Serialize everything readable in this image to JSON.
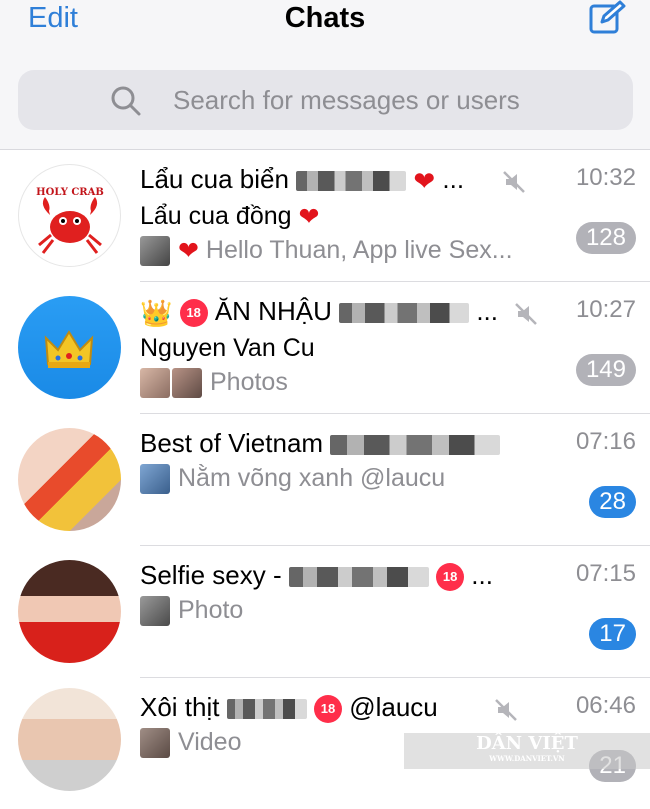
{
  "header": {
    "edit_label": "Edit",
    "title": "Chats",
    "compose_icon": "compose-icon"
  },
  "search": {
    "placeholder": "Search for messages or users"
  },
  "chats": [
    {
      "name": "Lẩu cua biển",
      "time": "10:32",
      "sender": "Lẩu cua đồng",
      "preview": "Hello Thuan,  App live Sex...",
      "badge": "128",
      "avatar_text": "HOLY CRAB"
    },
    {
      "name": "ĂN NHẬU",
      "time": "10:27",
      "sender": "Nguyen Van Cu",
      "preview": "Photos",
      "badge": "149"
    },
    {
      "name": "Best of Vietnam",
      "time": "07:16",
      "preview": "Nằm võng xanh @laucu",
      "badge": "28"
    },
    {
      "name": "Selfie sexy -",
      "time": "07:15",
      "preview": "Photo",
      "badge": "17"
    },
    {
      "name": "Xôi thịt",
      "time": "06:46",
      "name_tail": "@laucu",
      "preview": "Video",
      "badge": "21"
    }
  ],
  "watermark": {
    "title": "DÂN VIỆT",
    "url": "WWW.DANVIET.VN"
  },
  "colors": {
    "accent": "#2f7fd8",
    "badge_muted": "#b2b2b8",
    "badge_unmuted": "#2a86e2",
    "ban_red": "#ff2e4a"
  }
}
